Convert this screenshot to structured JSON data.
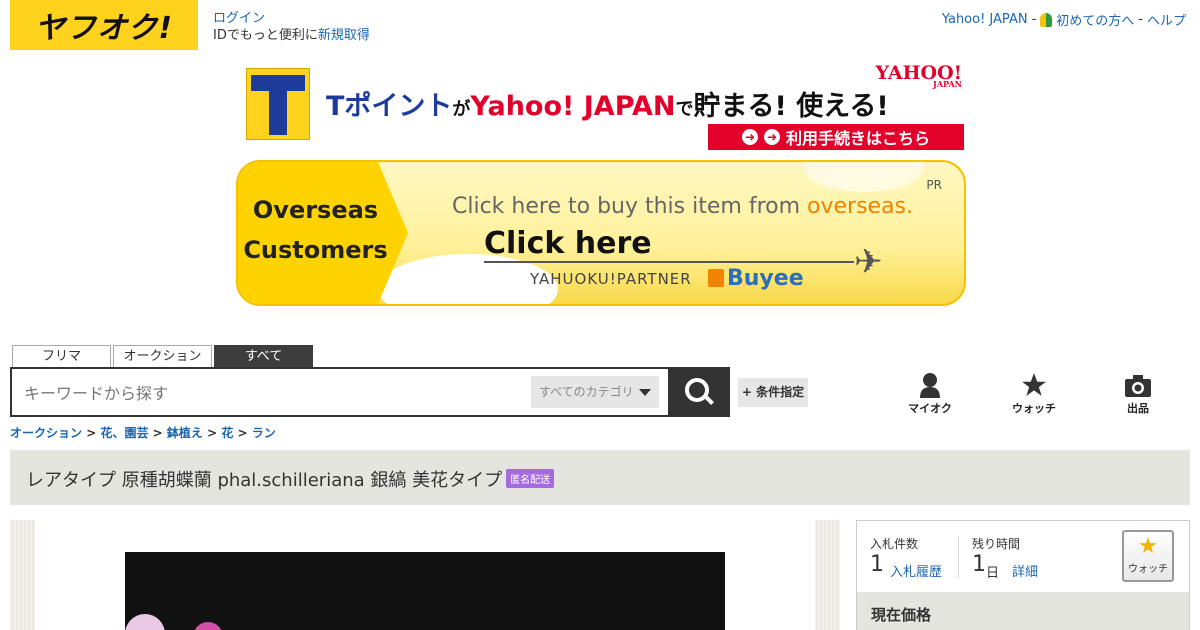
{
  "header": {
    "logo_text": "ヤフオク!",
    "login_label": "ログイン",
    "id_text": "IDでもっと便利に",
    "signup_label": "新規取得",
    "yahoo_japan_label": "Yahoo! JAPAN",
    "sep1": "-",
    "beginner_label": "初めての方へ",
    "sep2": "-",
    "help_label": "ヘルプ"
  },
  "tpoint_banner": {
    "t_point": "Tポイント",
    "ga": "が",
    "yahoo_japan": "Yahoo! JAPAN",
    "de": "で",
    "tail": "貯まる! 使える!",
    "yahoo_logo": "YAHOO!",
    "yahoo_logo_sub": "JAPAN",
    "procedure_label": "利用手続きはこちら"
  },
  "buyee_banner": {
    "overseas": "Overseas",
    "customers": "Customers",
    "msg_prefix": "Click here to buy this item from ",
    "msg_highlight": "overseas.",
    "click_here": "Click here",
    "partner": "YAHUOKU!PARTNER",
    "buyee": "Buyee",
    "pr": "PR"
  },
  "search": {
    "tabs": [
      "フリマ",
      "オークション",
      "すべて"
    ],
    "placeholder": "キーワードから探す",
    "category_label": "すべてのカテゴリ",
    "condition_label": "+ 条件指定"
  },
  "nav_icons": {
    "myauction": "マイオク",
    "watch": "ウォッチ",
    "sell": "出品"
  },
  "breadcrumb": [
    "オークション",
    "花、園芸",
    "鉢植え",
    "花",
    "ラン"
  ],
  "breadcrumb_sep": " > ",
  "item": {
    "title": "レアタイプ 原種胡蝶蘭 phal.schilleriana 銀縞 美花タイプ",
    "badge": "匿名配送"
  },
  "info": {
    "bids_label": "入札件数",
    "bids_value": "1",
    "bid_history_label": "入札履歴",
    "time_label": "残り時間",
    "time_value": "1",
    "time_unit": "日",
    "detail_label": "詳細",
    "watch_label": "ウォッチ",
    "current_price_label": "現在価格"
  }
}
